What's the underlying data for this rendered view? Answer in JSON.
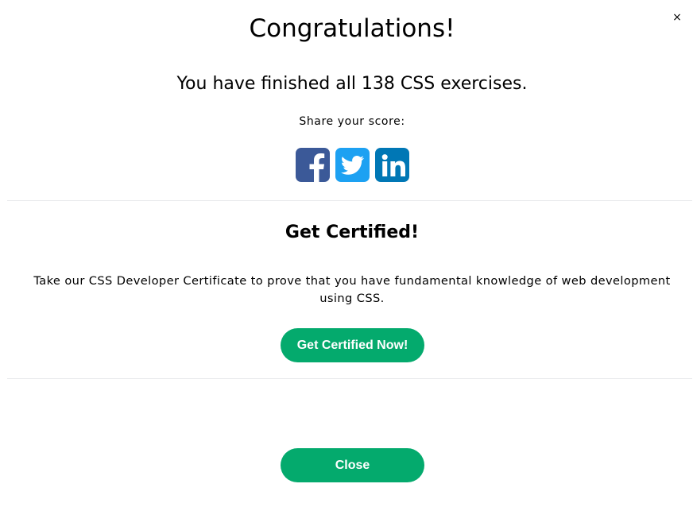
{
  "modal": {
    "close_symbol": "×",
    "title": "Congratulations!",
    "finished_text": "You have finished all 138 CSS exercises.",
    "share_label": "Share your score:",
    "social_icons": [
      {
        "name": "facebook-icon",
        "color": "#3b5998"
      },
      {
        "name": "twitter-icon",
        "color": "#1da1f2"
      },
      {
        "name": "linkedin-icon",
        "color": "#0077b5"
      }
    ],
    "certificate": {
      "heading": "Get Certified!",
      "description": "Take our CSS Developer Certificate to prove that you have fundamental knowledge of web development using CSS.",
      "button_label": "Get Certified Now!"
    },
    "close_button_label": "Close",
    "accent_color": "#04aa6d"
  }
}
